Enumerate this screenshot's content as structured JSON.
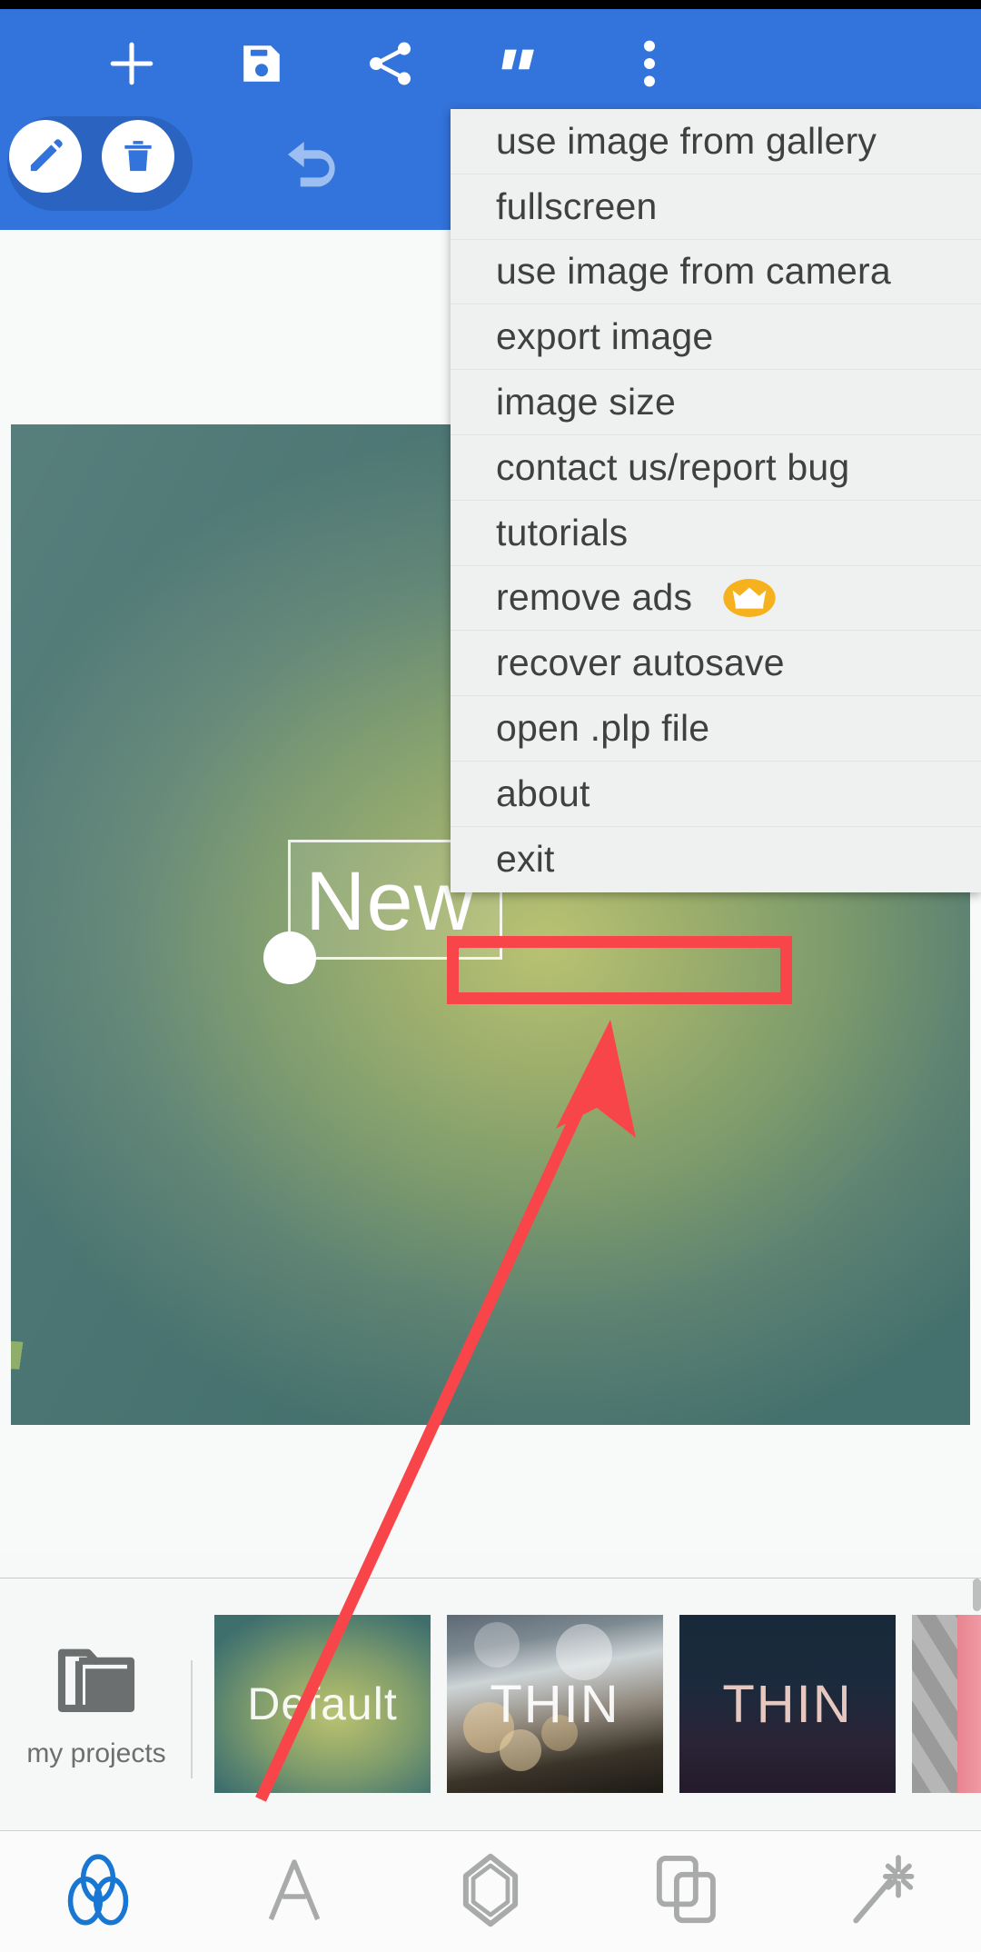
{
  "app": {
    "accent_blue": "#3273DC",
    "chip_blue": "#2A63C0",
    "highlight_red": "#F8454A",
    "menu_bg": "#EFF0F0",
    "menu_text": "#404040"
  },
  "toolbar": {
    "icons": [
      {
        "name": "add-icon",
        "label": "add"
      },
      {
        "name": "save-icon",
        "label": "save"
      },
      {
        "name": "share-icon",
        "label": "share"
      },
      {
        "name": "quote-icon",
        "label": "quote"
      },
      {
        "name": "overflow-menu-icon",
        "label": "more options"
      }
    ],
    "edit_label": "edit",
    "delete_label": "delete",
    "undo_label": "undo"
  },
  "canvas": {
    "text_object_value": "New",
    "handle_label": "resize handle"
  },
  "menu": {
    "items": [
      {
        "label": "use image from gallery",
        "badge": null,
        "highlighted": false
      },
      {
        "label": "fullscreen",
        "badge": null,
        "highlighted": false
      },
      {
        "label": "use image from camera",
        "badge": null,
        "highlighted": false
      },
      {
        "label": "export image",
        "badge": null,
        "highlighted": false
      },
      {
        "label": "image size",
        "badge": null,
        "highlighted": false
      },
      {
        "label": "contact us/report bug",
        "badge": null,
        "highlighted": false
      },
      {
        "label": "tutorials",
        "badge": null,
        "highlighted": false
      },
      {
        "label": "remove ads",
        "badge": "crown-icon",
        "highlighted": false
      },
      {
        "label": "recover autosave",
        "badge": null,
        "highlighted": false
      },
      {
        "label": "open .plp file",
        "badge": null,
        "highlighted": true
      },
      {
        "label": "about",
        "badge": null,
        "highlighted": false
      },
      {
        "label": "exit",
        "badge": null,
        "highlighted": false
      }
    ]
  },
  "annotation": {
    "target_label": "open .plp file",
    "arrow_color": "#F8454A",
    "box_color": "#F8454A"
  },
  "strip": {
    "my_projects_label": "my projects",
    "thumbnails": [
      {
        "label": "Default"
      },
      {
        "label": "THIN"
      },
      {
        "label": "THIN"
      },
      {
        "label": ""
      }
    ]
  },
  "bottomnav": {
    "items": [
      {
        "name": "filters-icon",
        "label": "filters",
        "active": true
      },
      {
        "name": "text-icon",
        "label": "text",
        "active": false
      },
      {
        "name": "shape-icon",
        "label": "shape",
        "active": false
      },
      {
        "name": "layers-icon",
        "label": "layers",
        "active": false
      },
      {
        "name": "magic-wand-icon",
        "label": "effects",
        "active": false
      }
    ]
  }
}
